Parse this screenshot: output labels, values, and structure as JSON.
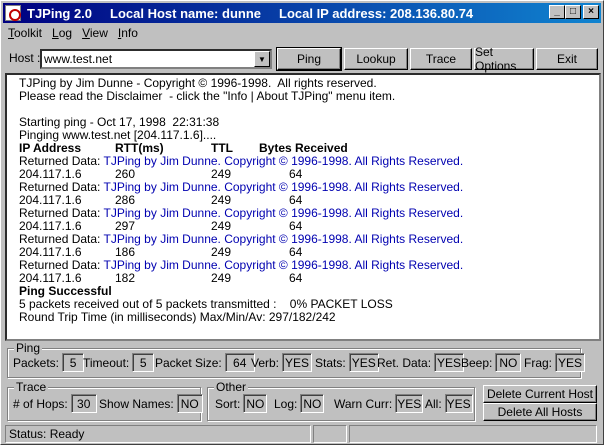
{
  "window": {
    "title_app": "TJPing 2.0",
    "title_host": "Local Host name:  dunne",
    "title_ip": "Local IP address: 208.136.80.74",
    "min_glyph": "_",
    "max_glyph": "□",
    "close_glyph": "×"
  },
  "menu": [
    {
      "first": "T",
      "rest": "oolkit"
    },
    {
      "first": "L",
      "rest": "og"
    },
    {
      "first": "V",
      "rest": "iew"
    },
    {
      "first": "I",
      "rest": "nfo"
    }
  ],
  "toolbar": {
    "host_label": "Host :",
    "host_value": "www.test.net",
    "dropdown_glyph": "▼",
    "ping": "Ping",
    "lookup": "Lookup",
    "trace": "Trace",
    "set_options": "Set Options",
    "exit": "Exit"
  },
  "output": {
    "line1": "TJPing by Jim Dunne - Copyright © 1996-1998.  All rights reserved.",
    "line2": "Please read the Disclaimer  - click the \"Info | About TJPing\" menu item.",
    "start": "Starting ping - Oct 17, 1998  22:31:38",
    "pinging": "Pinging www.test.net [204.117.1.6]....",
    "headers": {
      "ip": "IP Address",
      "rtt": "RTT(ms)",
      "ttl": "TTL",
      "bytes": "Bytes Received"
    },
    "returned_label": "Returned Data: ",
    "returned_text": "TJPing by Jim Dunne. Copyright © 1996-1998. All Rights Reserved.",
    "rows": [
      {
        "ip": "204.117.1.6",
        "rtt": "260",
        "ttl": "249",
        "bytes": "64"
      },
      {
        "ip": "204.117.1.6",
        "rtt": "286",
        "ttl": "249",
        "bytes": "64"
      },
      {
        "ip": "204.117.1.6",
        "rtt": "297",
        "ttl": "249",
        "bytes": "64"
      },
      {
        "ip": "204.117.1.6",
        "rtt": "186",
        "ttl": "249",
        "bytes": "64"
      },
      {
        "ip": "204.117.1.6",
        "rtt": "182",
        "ttl": "249",
        "bytes": "64"
      }
    ],
    "success": "Ping Successful",
    "summary": "5 packets received out of 5 packets transmitted :    0% PACKET LOSS",
    "rtt_summary": "Round Trip Time (in milliseconds) Max/Min/Av: 297/182/242"
  },
  "ping_group": {
    "legend": "Ping",
    "packets_label": "Packets:",
    "packets": "5",
    "timeout_label": "Timeout:",
    "timeout": "5",
    "size_label": "Packet Size:",
    "size": "64",
    "verb_label": "Verb:",
    "verb": "YES",
    "stats_label": "Stats:",
    "stats": "YES",
    "retdata_label": "Ret. Data:",
    "retdata": "YES",
    "beep_label": "Beep:",
    "beep": "NO",
    "frag_label": "Frag:",
    "frag": "YES"
  },
  "trace_group": {
    "legend": "Trace",
    "hops_label": "# of Hops:",
    "hops": "30",
    "shownames_label": "Show Names:",
    "shownames": "NO"
  },
  "other_group": {
    "legend": "Other",
    "sort_label": "Sort:",
    "sort": "NO",
    "log_label": "Log:",
    "log": "NO",
    "warn_label": "Warn Curr:",
    "warn": "YES",
    "all_label": "All:",
    "all": "YES"
  },
  "actions": {
    "delete_current": "Delete Current Host",
    "delete_all": "Delete All Hosts"
  },
  "status": {
    "text": "Status: Ready"
  }
}
